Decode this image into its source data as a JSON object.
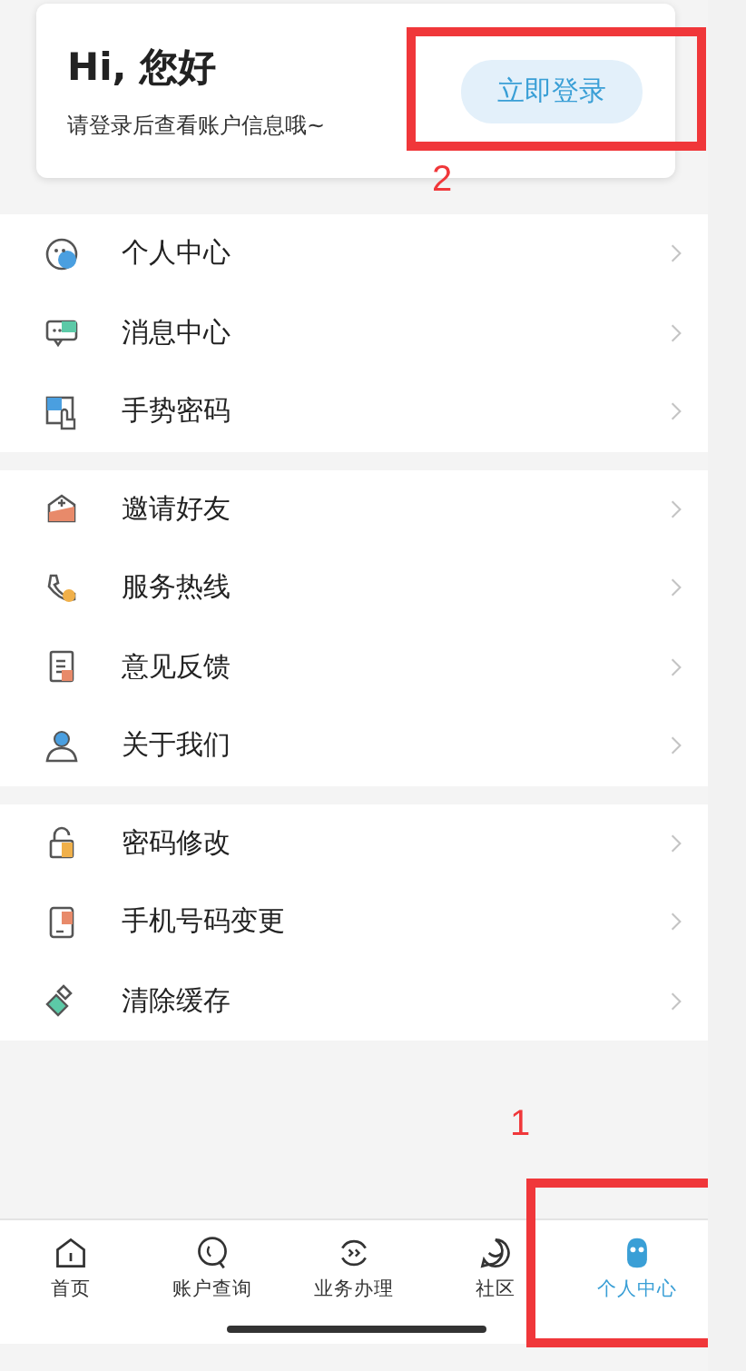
{
  "profile_card": {
    "greeting": "Hi, 您好",
    "subtitle": "请登录后查看账户信息哦~",
    "login_button": "立即登录"
  },
  "menu_groups": [
    {
      "items": [
        {
          "label": "个人中心"
        },
        {
          "label": "消息中心"
        },
        {
          "label": "手势密码"
        }
      ]
    },
    {
      "items": [
        {
          "label": "邀请好友"
        },
        {
          "label": "服务热线"
        },
        {
          "label": "意见反馈"
        },
        {
          "label": "关于我们"
        }
      ]
    },
    {
      "items": [
        {
          "label": "密码修改"
        },
        {
          "label": "手机号码变更"
        },
        {
          "label": "清除缓存"
        }
      ]
    }
  ],
  "tab_bar": [
    {
      "label": "首页",
      "selected": false
    },
    {
      "label": "账户查询",
      "selected": false
    },
    {
      "label": "业务办理",
      "selected": false
    },
    {
      "label": "社区",
      "selected": false
    },
    {
      "label": "个人中心",
      "selected": true
    }
  ],
  "annotations": [
    {
      "label": "2"
    },
    {
      "label": "1"
    }
  ]
}
